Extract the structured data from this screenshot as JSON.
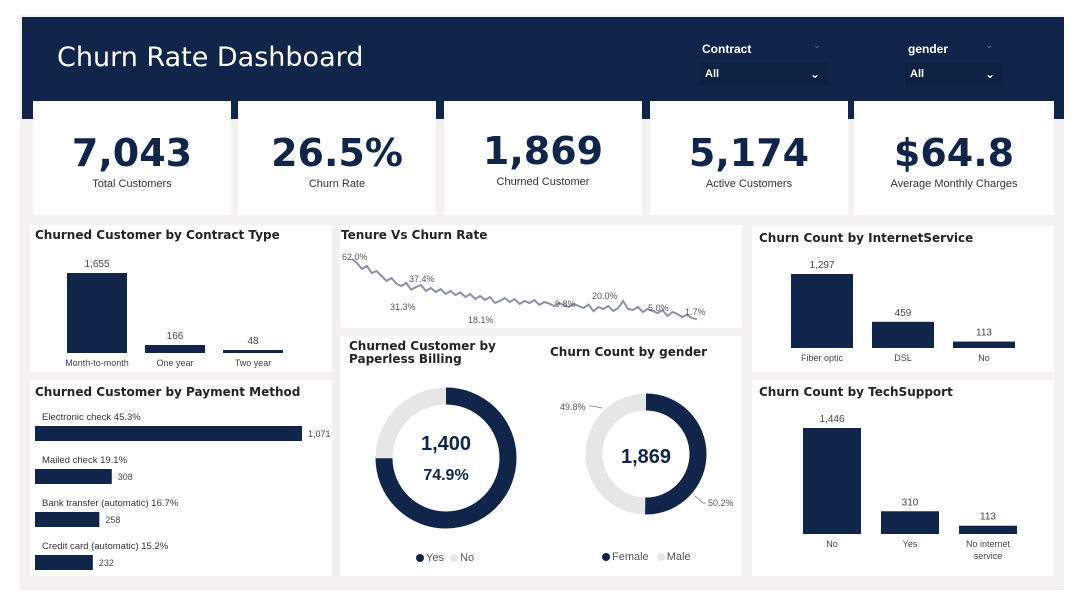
{
  "header": {
    "title": "Churn Rate Dashboard",
    "slicers": [
      {
        "label": "Contract",
        "value": "All"
      },
      {
        "label": "gender",
        "value": "All"
      }
    ]
  },
  "kpis": [
    {
      "value": "7,043",
      "label": "Total Customers"
    },
    {
      "value": "26.5%",
      "label": "Churn Rate"
    },
    {
      "value": "1,869",
      "label": "Churned Customer"
    },
    {
      "value": "5,174",
      "label": "Active Customers"
    },
    {
      "value": "$64.8",
      "label": "Average Monthly Charges"
    }
  ],
  "colors": {
    "navy": "#102549",
    "light_gray": "#e6e6e6",
    "line_gray": "#8a93a3"
  },
  "chart_data": [
    {
      "id": "contract",
      "type": "bar",
      "title": "Churned Customer by Contract Type",
      "categories": [
        "Month-to-month",
        "One year",
        "Two year"
      ],
      "values": [
        1655,
        166,
        48
      ],
      "value_labels": [
        "1,655",
        "166",
        "48"
      ]
    },
    {
      "id": "tenure",
      "type": "line",
      "title": "Tenure Vs Churn Rate",
      "values": [
        62.0,
        58.0,
        52.0,
        55.0,
        48.0,
        50.0,
        45.0,
        40.0,
        43.0,
        37.4,
        35.0,
        38.0,
        31.3,
        34.0,
        36.0,
        30.0,
        33.0,
        29.0,
        32.0,
        27.0,
        30.0,
        26.0,
        28.5,
        24.0,
        27.0,
        22.0,
        25.0,
        21.0,
        24.0,
        18.1,
        20.0,
        23.0,
        19.0,
        22.0,
        17.0,
        20.0,
        18.0,
        21.0,
        16.0,
        19.0,
        17.5,
        15.0,
        18.0,
        16.0,
        14.0,
        17.0,
        15.0,
        13.0,
        16.5,
        9.8,
        14.0,
        12.0,
        15.0,
        10.0,
        13.0,
        20.0,
        12.0,
        11.0,
        14.0,
        9.0,
        12.0,
        10.0,
        8.0,
        11.0,
        5.0,
        9.0,
        7.0,
        4.0,
        6.0,
        3.0,
        1.7
      ],
      "annotations": [
        "62.0%",
        "37.4%",
        "31.3%",
        "18.1%",
        "9.8%",
        "20.0%",
        "5.0%",
        "1.7%"
      ]
    },
    {
      "id": "internet",
      "type": "bar",
      "title": "Churn Count by InternetService",
      "categories": [
        "Fiber optic",
        "DSL",
        "No"
      ],
      "values": [
        1297,
        459,
        113
      ],
      "value_labels": [
        "1,297",
        "459",
        "113"
      ]
    },
    {
      "id": "payment",
      "type": "bar",
      "orientation": "horizontal",
      "title": "Churned Customer by Payment Method",
      "categories": [
        "Electronic check 45.3%",
        "Mailed check 19.1%",
        "Bank transfer (automatic) 16.7%",
        "Credit card (automatic) 15.2%"
      ],
      "values": [
        1071,
        308,
        258,
        232
      ],
      "value_labels": [
        "1,071",
        "308",
        "258",
        "232"
      ]
    },
    {
      "id": "paperless",
      "type": "pie",
      "title": "Churned Customer by Paperless Billing",
      "center_value": "1,400",
      "center_pct": "74.9%",
      "slices": [
        {
          "name": "Yes",
          "value": 74.9
        },
        {
          "name": "No",
          "value": 25.1
        }
      ],
      "legend": [
        "Yes",
        "No"
      ]
    },
    {
      "id": "gender",
      "type": "pie",
      "title": "Churn Count by gender",
      "center_value": "1,869",
      "slices": [
        {
          "name": "Female",
          "value": 50.2
        },
        {
          "name": "Male",
          "value": 49.8
        }
      ],
      "slice_labels": [
        "50.2%",
        "49.8%"
      ],
      "legend": [
        "Female",
        "Male"
      ]
    },
    {
      "id": "techsupport",
      "type": "bar",
      "title": "Churn Count by TechSupport",
      "categories": [
        "No",
        "Yes",
        "No internet service"
      ],
      "values": [
        1446,
        310,
        113
      ],
      "value_labels": [
        "1,446",
        "310",
        "113"
      ]
    }
  ]
}
